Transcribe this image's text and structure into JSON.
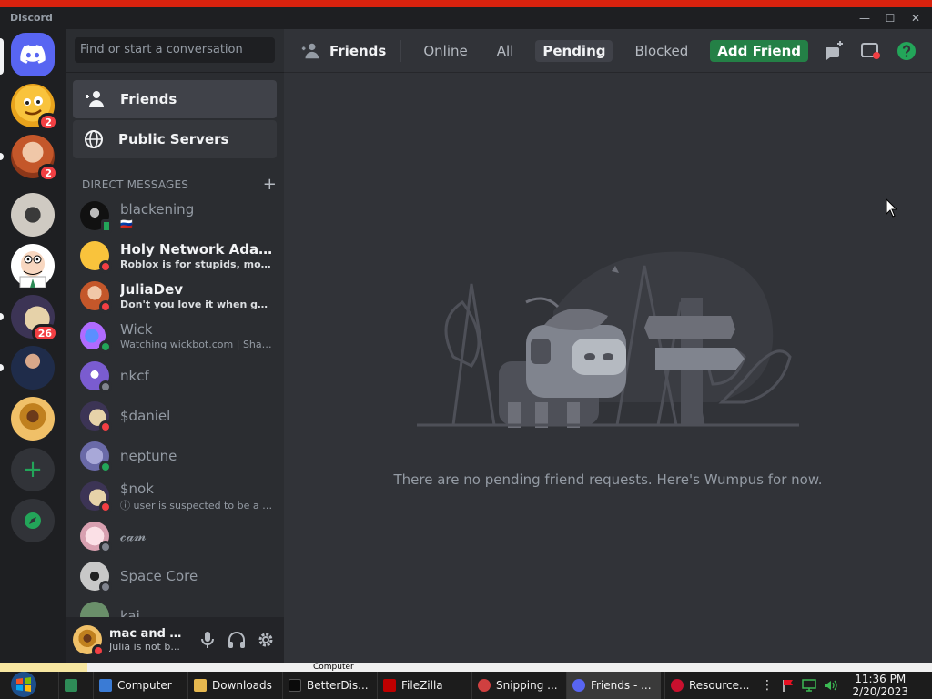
{
  "window": {
    "title": "Discord"
  },
  "rail": {
    "servers": [
      {
        "id": "home",
        "label": ""
      },
      {
        "id": "s1",
        "badge": "2"
      },
      {
        "id": "s2",
        "badge": "2"
      },
      {
        "id": "s3",
        "badge": ""
      },
      {
        "id": "s4",
        "badge": ""
      },
      {
        "id": "s5",
        "badge": "26"
      },
      {
        "id": "s6",
        "badge": ""
      },
      {
        "id": "s7",
        "badge": ""
      }
    ]
  },
  "search": {
    "placeholder": "Find or start a conversation"
  },
  "nav": {
    "friends": "Friends",
    "public_servers": "Public Servers"
  },
  "dm_header": "DIRECT MESSAGES",
  "dms": [
    {
      "name": "blackening",
      "sub": "🇷🇺",
      "status": "mobile",
      "bright": false
    },
    {
      "name": "Holy Network Adapter",
      "sub": "Roblox is for stupids, motherf...",
      "status": "dnd",
      "bright": true
    },
    {
      "name": "JuliaDev",
      "sub": "Don't you love it when govern...",
      "status": "dnd",
      "bright": true
    },
    {
      "name": "Wick",
      "sub": "Watching wickbot.com | Shar...",
      "status": "online",
      "bright": false
    },
    {
      "name": "nkcf",
      "sub": "",
      "status": "offline",
      "bright": false
    },
    {
      "name": "$daniel",
      "sub": "",
      "status": "dnd",
      "bright": false
    },
    {
      "name": "neptune",
      "sub": "",
      "status": "online",
      "bright": false
    },
    {
      "name": "$nok",
      "sub": "ⓘ user is suspected to be a p...",
      "status": "dnd",
      "bright": false
    },
    {
      "name": "𝓬𝓪𝓶",
      "sub": "",
      "status": "offline",
      "bright": false
    },
    {
      "name": "Space Core",
      "sub": "",
      "status": "offline",
      "bright": false
    },
    {
      "name": "kai",
      "sub": "",
      "status": "offline",
      "bright": false
    }
  ],
  "user": {
    "name": "mac and c...",
    "status": "Julia is not b..."
  },
  "topbar": {
    "title": "Friends",
    "tabs": {
      "online": "Online",
      "all": "All",
      "pending": "Pending",
      "blocked": "Blocked",
      "add_friend": "Add Friend"
    }
  },
  "empty_message": "There are no pending friend requests. Here's Wumpus for now.",
  "taskbar": {
    "items": [
      {
        "label": "Computer"
      },
      {
        "label": "Downloads"
      },
      {
        "label": "BetterDis..."
      },
      {
        "label": "FileZilla"
      },
      {
        "label": "Snipping ..."
      },
      {
        "label": "Friends - ..."
      },
      {
        "label": "Resource..."
      }
    ],
    "behind_window_label": "Computer",
    "time": "11:36 PM",
    "date": "2/20/2023"
  },
  "colors": {
    "blurple": "#5865f2",
    "green": "#23a559",
    "red": "#f23f43",
    "add_friend": "#248046"
  }
}
